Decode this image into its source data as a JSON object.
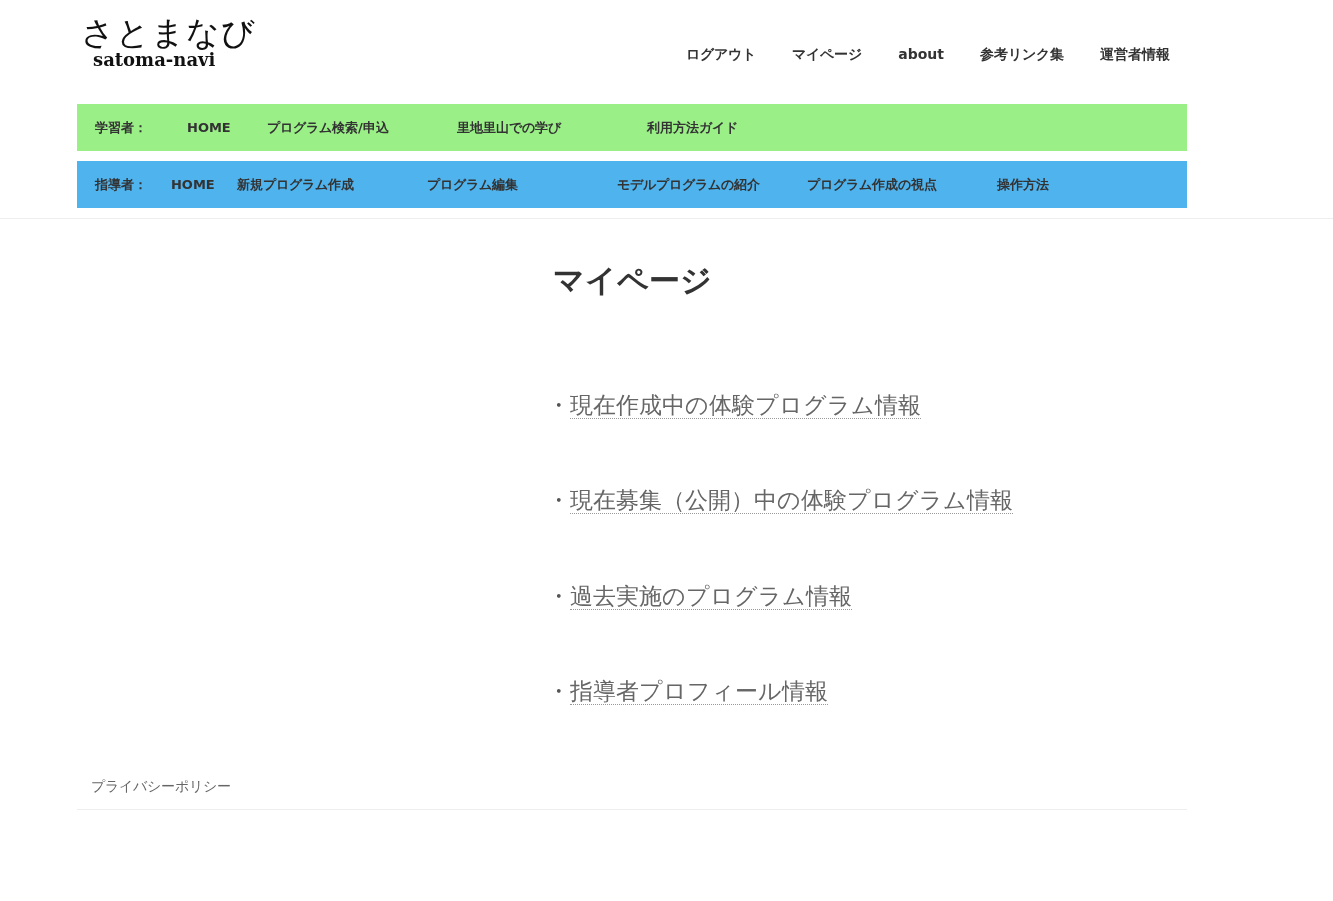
{
  "logo": {
    "title": "さとまなび",
    "subtitle": "satoma-navi"
  },
  "top_nav": [
    "ログアウト",
    "マイページ",
    "about",
    "参考リンク集",
    "運営者情報"
  ],
  "menus": [
    {
      "kind": "learner",
      "label": "学習者：",
      "items": [
        "HOME",
        "プログラム検索/申込",
        "里地里山での学び",
        "利用方法ガイド"
      ]
    },
    {
      "kind": "instructor",
      "label": "指導者：",
      "items": [
        "HOME",
        "新規プログラム作成",
        "プログラム編集",
        "モデルプログラムの紹介",
        "プログラム作成の視点",
        "操作方法"
      ]
    }
  ],
  "page_title": "マイページ",
  "links": [
    {
      "bullet": "・",
      "text": "現在作成中の体験プログラム情報"
    },
    {
      "bullet": "・",
      "text": "現在募集（公開）中の体験プログラム情報"
    },
    {
      "bullet": "・",
      "text": "過去実施のプログラム情報"
    },
    {
      "bullet": "・",
      "text": "指導者プロフィール情報"
    }
  ],
  "footer": {
    "link": "プライバシーポリシー"
  }
}
